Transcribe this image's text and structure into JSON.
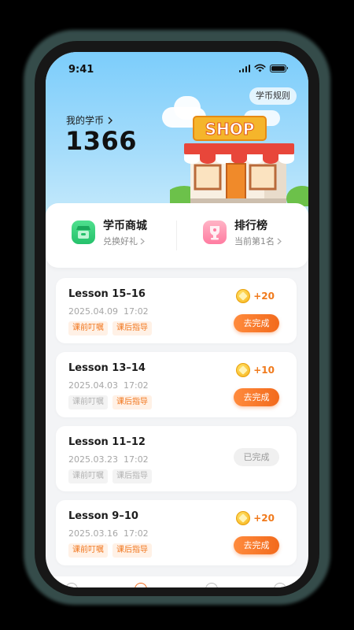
{
  "status_bar": {
    "time": "9:41"
  },
  "hero": {
    "rules_label": "学币规则",
    "coin_label": "我的学币",
    "coin_value": "1366",
    "shop_sign": "SHOP"
  },
  "quick_links": [
    {
      "title": "学币商城",
      "subtitle": "兑换好礼"
    },
    {
      "title": "排行榜",
      "subtitle": "当前第1名"
    }
  ],
  "lessons": [
    {
      "title": "Lesson 15–16",
      "date": "2025.04.09",
      "time": "17:02",
      "tags": [
        {
          "label": "课前叮嘱",
          "active": true
        },
        {
          "label": "课后指导",
          "active": true
        }
      ],
      "reward": "+20",
      "action": "去完成",
      "status": "todo"
    },
    {
      "title": "Lesson 13–14",
      "date": "2025.04.03",
      "time": "17:02",
      "tags": [
        {
          "label": "课前叮嘱",
          "active": false
        },
        {
          "label": "课后指导",
          "active": true
        }
      ],
      "reward": "+10",
      "action": "去完成",
      "status": "todo"
    },
    {
      "title": "Lesson 11–12",
      "date": "2025.03.23",
      "time": "17:02",
      "tags": [
        {
          "label": "课前叮嘱",
          "active": false
        },
        {
          "label": "课后指导",
          "active": false
        }
      ],
      "reward": "",
      "action": "已完成",
      "status": "done"
    },
    {
      "title": "Lesson 9–10",
      "date": "2025.03.16",
      "time": "17:02",
      "tags": [
        {
          "label": "课前叮嘱",
          "active": true
        },
        {
          "label": "课后指导",
          "active": true
        }
      ],
      "reward": "+20",
      "action": "去完成",
      "status": "todo"
    }
  ],
  "colors": {
    "accent": "#f26a1c",
    "sky": "#7ccdfb",
    "tag_bg": "#fff1e6"
  },
  "icons": [
    "signal-icon",
    "wifi-icon",
    "battery-icon",
    "chevron-right-icon",
    "store-icon",
    "trophy-icon",
    "coin-icon"
  ]
}
